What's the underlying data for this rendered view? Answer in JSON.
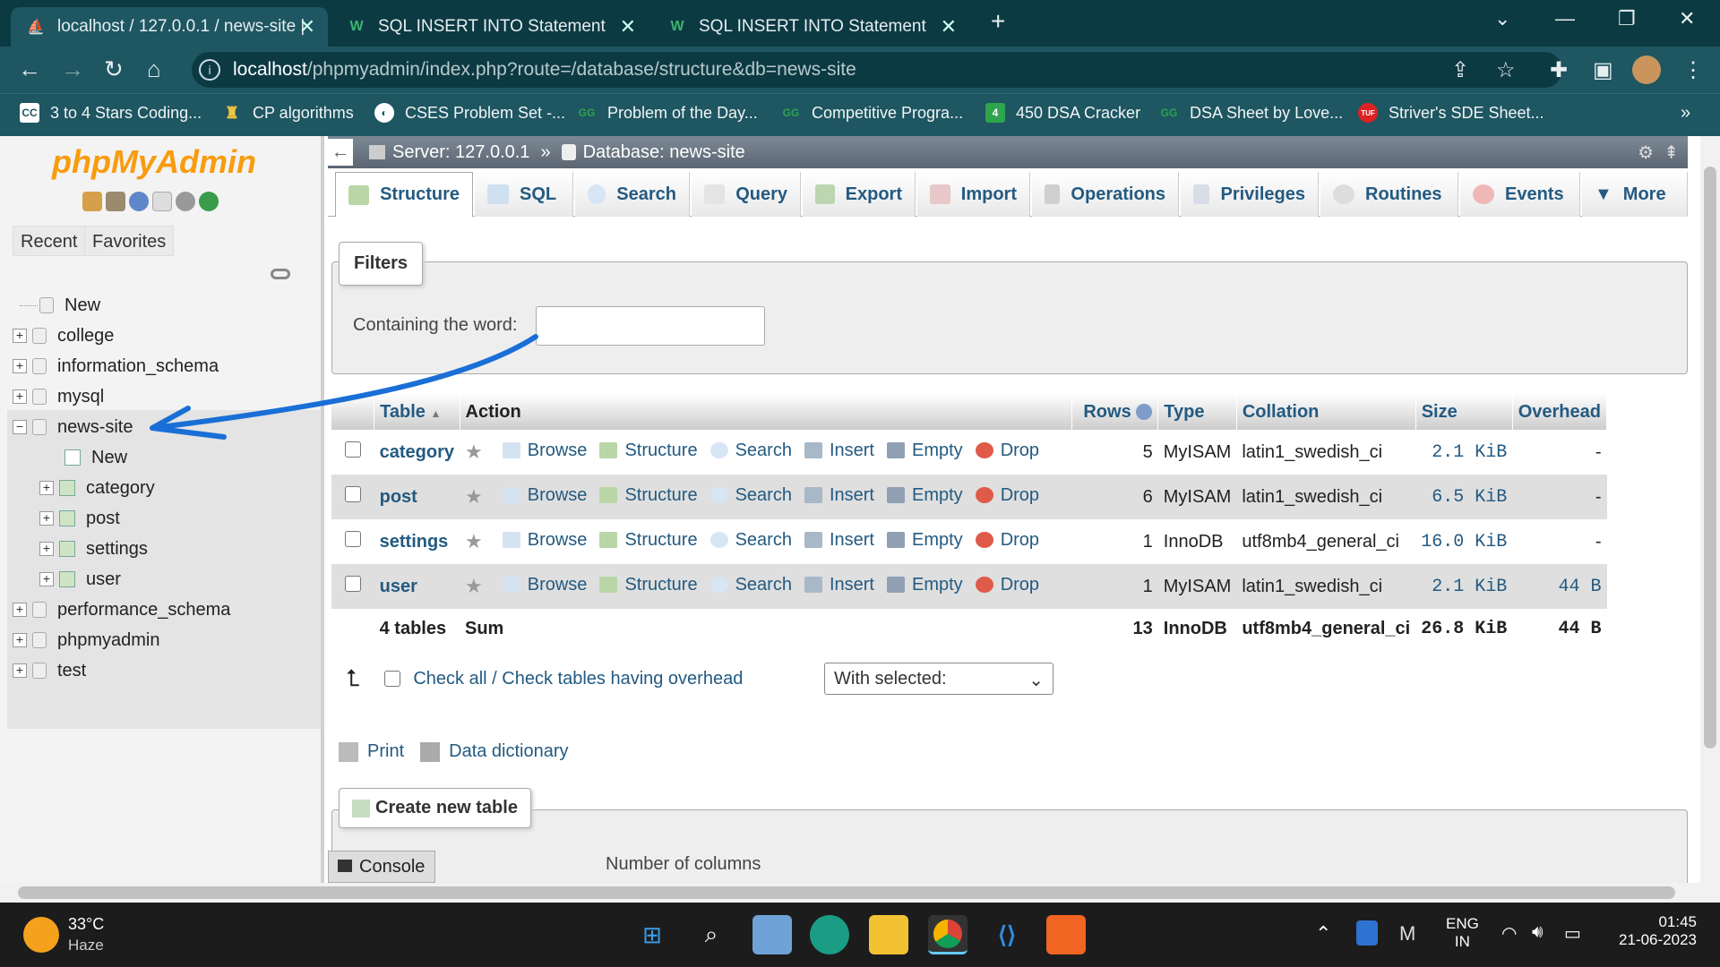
{
  "browser": {
    "tabs": [
      {
        "title": "localhost / 127.0.0.1 / news-site |",
        "active": true
      },
      {
        "title": "SQL INSERT INTO Statement",
        "active": false
      },
      {
        "title": "SQL INSERT INTO Statement",
        "active": false
      }
    ],
    "url_host": "localhost",
    "url_path": "/phpmyadmin/index.php?route=/database/structure&db=news-site",
    "bookmarks": [
      "3 to 4 Stars Coding...",
      "CP algorithms",
      "CSES Problem Set -...",
      "Problem of the Day...",
      "Competitive Progra...",
      "450 DSA Cracker",
      "DSA Sheet by Love...",
      "Striver's SDE Sheet..."
    ]
  },
  "sidebar": {
    "logo_php": "php",
    "logo_myadmin": "MyAdmin",
    "tabs": [
      "Recent",
      "Favorites"
    ],
    "tree": {
      "new": "New",
      "dbs_top": [
        "college",
        "information_schema",
        "mysql"
      ],
      "current_db": "news-site",
      "current_new": "New",
      "tables": [
        "category",
        "post",
        "settings",
        "user"
      ],
      "dbs_bottom": [
        "performance_schema",
        "phpmyadmin",
        "test"
      ]
    }
  },
  "breadcrumb": {
    "server": "Server: 127.0.0.1",
    "sep": "»",
    "database": "Database: news-site"
  },
  "main_tabs": [
    "Structure",
    "SQL",
    "Search",
    "Query",
    "Export",
    "Import",
    "Operations",
    "Privileges",
    "Routines",
    "Events",
    "More"
  ],
  "filters": {
    "legend": "Filters",
    "label": "Containing the word:",
    "value": ""
  },
  "table": {
    "headers": [
      "Table",
      "Action",
      "Rows",
      "Type",
      "Collation",
      "Size",
      "Overhead"
    ],
    "actions": [
      "Browse",
      "Structure",
      "Search",
      "Insert",
      "Empty",
      "Drop"
    ],
    "rows": [
      {
        "name": "category",
        "rows": "5",
        "type": "MyISAM",
        "collation": "latin1_swedish_ci",
        "size": "2.1 KiB",
        "overhead": "-"
      },
      {
        "name": "post",
        "rows": "6",
        "type": "MyISAM",
        "collation": "latin1_swedish_ci",
        "size": "6.5 KiB",
        "overhead": "-"
      },
      {
        "name": "settings",
        "rows": "1",
        "type": "InnoDB",
        "collation": "utf8mb4_general_ci",
        "size": "16.0 KiB",
        "overhead": "-"
      },
      {
        "name": "user",
        "rows": "1",
        "type": "MyISAM",
        "collation": "latin1_swedish_ci",
        "size": "2.1 KiB",
        "overhead": "44 B"
      }
    ],
    "sum": {
      "label": "4 tables",
      "sum": "Sum",
      "rows": "13",
      "type": "InnoDB",
      "collation": "utf8mb4_general_ci",
      "size": "26.8 KiB",
      "overhead": "44 B"
    }
  },
  "bulk": {
    "check_all": "Check all / Check tables having overhead",
    "with_selected": "With selected:"
  },
  "links": {
    "print": "Print",
    "data_dictionary": "Data dictionary"
  },
  "create": {
    "legend": "Create new table",
    "num_columns": "Number of columns"
  },
  "console": "Console",
  "taskbar": {
    "temp": "33°C",
    "weather": "Haze",
    "lang1": "ENG",
    "lang2": "IN",
    "time": "01:45",
    "date": "21-06-2023"
  },
  "colors": {
    "link": "#235a81",
    "chrome_dark": "#0c3a43",
    "chrome": "#1e5661",
    "annotation": "#1a6fd6"
  }
}
